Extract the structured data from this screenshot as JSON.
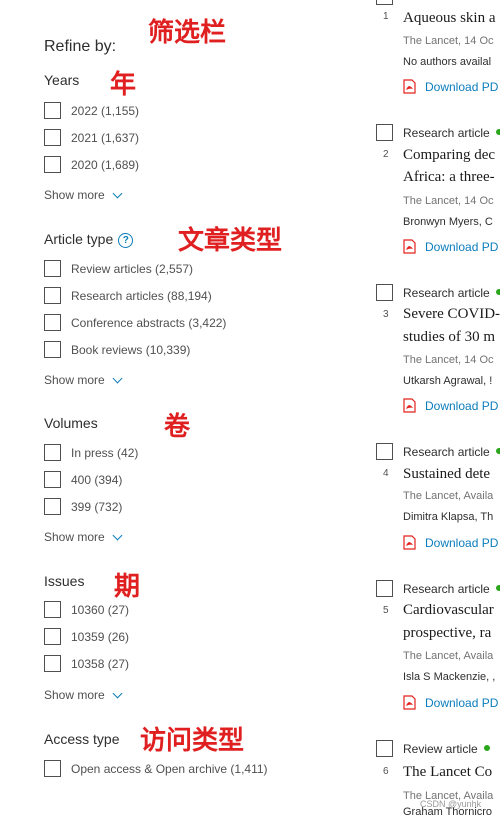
{
  "sidebar": {
    "title": "Refine by:",
    "years": {
      "title": "Years",
      "items": [
        {
          "label": "2022 (1,155)"
        },
        {
          "label": "2021 (1,637)"
        },
        {
          "label": "2020 (1,689)"
        }
      ],
      "show_more": "Show more"
    },
    "article_type": {
      "title": "Article type",
      "help_icon": "?",
      "items": [
        {
          "label": "Review articles (2,557)"
        },
        {
          "label": "Research articles (88,194)"
        },
        {
          "label": "Conference abstracts (3,422)"
        },
        {
          "label": "Book reviews (10,339)"
        }
      ],
      "show_more": "Show more"
    },
    "volumes": {
      "title": "Volumes",
      "items": [
        {
          "label": "In press (42)"
        },
        {
          "label": "400 (394)"
        },
        {
          "label": "399 (732)"
        }
      ],
      "show_more": "Show more"
    },
    "issues": {
      "title": "Issues",
      "items": [
        {
          "label": "10360 (27)"
        },
        {
          "label": "10359 (26)"
        },
        {
          "label": "10358 (27)"
        }
      ],
      "show_more": "Show more"
    },
    "access_type": {
      "title": "Access type",
      "items": [
        {
          "label": "Open access & Open archive (1,411)"
        }
      ]
    }
  },
  "annotations": {
    "filter_bar": "筛选栏",
    "year": "年",
    "article_type": "文章类型",
    "volume": "卷",
    "issue": "期",
    "access_type": "访问类型",
    "color": "#e02020"
  },
  "results": [
    {
      "number": "1",
      "title": "Aqueous skin a",
      "source": "The Lancet, 14 Oc",
      "authors": "No authors availal",
      "download": "Download PD"
    },
    {
      "type": "Research article",
      "number": "2",
      "title": "Comparing dec",
      "title2": "Africa: a three-",
      "source": "The Lancet, 14 Oc",
      "authors": "Bronwyn Myers, C",
      "download": "Download PD"
    },
    {
      "type": "Research article",
      "number": "3",
      "title": "Severe COVID-",
      "title2": "studies of 30 m",
      "source": "The Lancet, 14 Oc",
      "authors": "Utkarsh Agrawal, !",
      "download": "Download PD"
    },
    {
      "type": "Research article",
      "number": "4",
      "title": "Sustained dete",
      "source": "The Lancet, Availa",
      "authors": "Dimitra Klapsa, Th",
      "download": "Download PD"
    },
    {
      "type": "Research article",
      "number": "5",
      "title": "Cardiovascular",
      "title2": "prospective, ra",
      "source": "The Lancet, Availa",
      "authors": "Isla S Mackenzie, ,",
      "download": "Download PD"
    },
    {
      "type": "Review article",
      "number": "6",
      "title": "The Lancet Co",
      "source": "The Lancet, Availa",
      "authors": "Graham Thornicro"
    }
  ],
  "watermark": "CSDN @yunhk",
  "colors": {
    "link": "#0c7dbb",
    "open_access_dot": "#29a61b",
    "pdf_red": "#e2231a"
  },
  "icons": {
    "pdf": "pdf-icon",
    "help": "help-icon",
    "chevron": "chevron-down-icon",
    "dot": "open-access-dot-icon"
  }
}
